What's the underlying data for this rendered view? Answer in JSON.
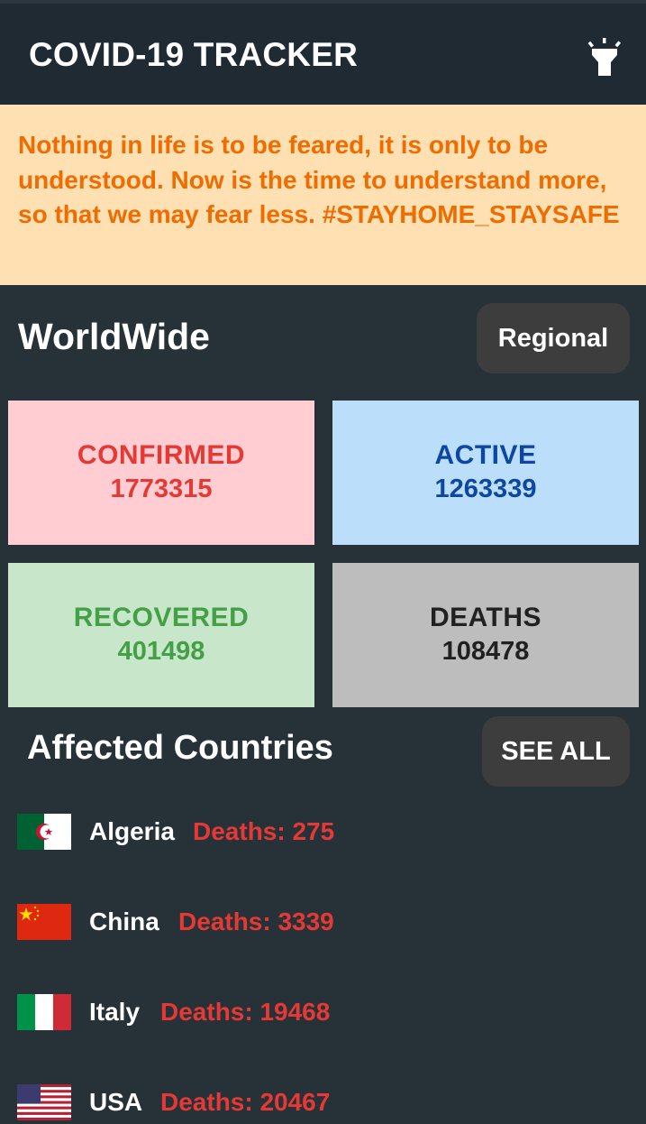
{
  "app": {
    "title": "COVID-19 TRACKER",
    "theme_icon": "flashlight-icon"
  },
  "quote": {
    "text": "Nothing in life is to be feared, it is only to be understood. Now is the time to understand more, so that we may fear less. #STAYHOME_STAYSAFE"
  },
  "worldwide": {
    "title": "WorldWide",
    "regional_label": "Regional",
    "cards": [
      {
        "label": "CONFIRMED",
        "value": "1773315",
        "color": "#e53935",
        "bg": "#ffcdd2"
      },
      {
        "label": "ACTIVE",
        "value": "1263339",
        "color": "#0d47a1",
        "bg": "#bbdefb"
      },
      {
        "label": "RECOVERED",
        "value": "401498",
        "color": "#43a047",
        "bg": "#c8e6c9"
      },
      {
        "label": "DEATHS",
        "value": "108478",
        "color": "#212121",
        "bg": "#bdbdbd"
      }
    ]
  },
  "affected": {
    "title": "Affected Countries",
    "see_all_label": "SEE ALL",
    "countries": [
      {
        "name": "Algeria",
        "deaths": "Deaths: 275",
        "flag": "algeria-flag"
      },
      {
        "name": "China",
        "deaths": "Deaths: 3339",
        "flag": "china-flag"
      },
      {
        "name": "Italy",
        "deaths": "Deaths: 19468",
        "flag": "italy-flag"
      },
      {
        "name": "USA",
        "deaths": "Deaths: 20467",
        "flag": "usa-flag"
      }
    ]
  }
}
